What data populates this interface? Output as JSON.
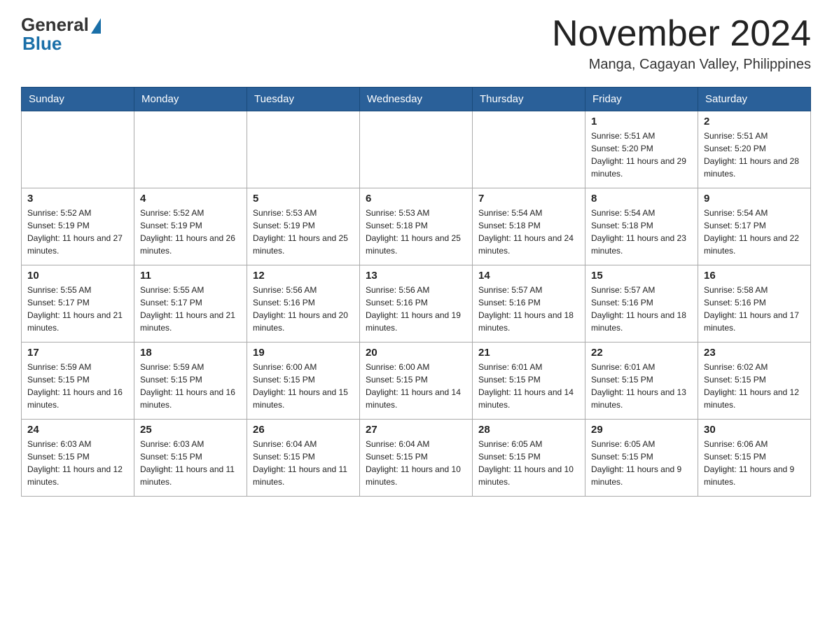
{
  "logo": {
    "general": "General",
    "blue": "Blue"
  },
  "header": {
    "title": "November 2024",
    "subtitle": "Manga, Cagayan Valley, Philippines"
  },
  "days_of_week": [
    "Sunday",
    "Monday",
    "Tuesday",
    "Wednesday",
    "Thursday",
    "Friday",
    "Saturday"
  ],
  "weeks": [
    [
      {
        "day": "",
        "info": ""
      },
      {
        "day": "",
        "info": ""
      },
      {
        "day": "",
        "info": ""
      },
      {
        "day": "",
        "info": ""
      },
      {
        "day": "",
        "info": ""
      },
      {
        "day": "1",
        "info": "Sunrise: 5:51 AM\nSunset: 5:20 PM\nDaylight: 11 hours and 29 minutes."
      },
      {
        "day": "2",
        "info": "Sunrise: 5:51 AM\nSunset: 5:20 PM\nDaylight: 11 hours and 28 minutes."
      }
    ],
    [
      {
        "day": "3",
        "info": "Sunrise: 5:52 AM\nSunset: 5:19 PM\nDaylight: 11 hours and 27 minutes."
      },
      {
        "day": "4",
        "info": "Sunrise: 5:52 AM\nSunset: 5:19 PM\nDaylight: 11 hours and 26 minutes."
      },
      {
        "day": "5",
        "info": "Sunrise: 5:53 AM\nSunset: 5:19 PM\nDaylight: 11 hours and 25 minutes."
      },
      {
        "day": "6",
        "info": "Sunrise: 5:53 AM\nSunset: 5:18 PM\nDaylight: 11 hours and 25 minutes."
      },
      {
        "day": "7",
        "info": "Sunrise: 5:54 AM\nSunset: 5:18 PM\nDaylight: 11 hours and 24 minutes."
      },
      {
        "day": "8",
        "info": "Sunrise: 5:54 AM\nSunset: 5:18 PM\nDaylight: 11 hours and 23 minutes."
      },
      {
        "day": "9",
        "info": "Sunrise: 5:54 AM\nSunset: 5:17 PM\nDaylight: 11 hours and 22 minutes."
      }
    ],
    [
      {
        "day": "10",
        "info": "Sunrise: 5:55 AM\nSunset: 5:17 PM\nDaylight: 11 hours and 21 minutes."
      },
      {
        "day": "11",
        "info": "Sunrise: 5:55 AM\nSunset: 5:17 PM\nDaylight: 11 hours and 21 minutes."
      },
      {
        "day": "12",
        "info": "Sunrise: 5:56 AM\nSunset: 5:16 PM\nDaylight: 11 hours and 20 minutes."
      },
      {
        "day": "13",
        "info": "Sunrise: 5:56 AM\nSunset: 5:16 PM\nDaylight: 11 hours and 19 minutes."
      },
      {
        "day": "14",
        "info": "Sunrise: 5:57 AM\nSunset: 5:16 PM\nDaylight: 11 hours and 18 minutes."
      },
      {
        "day": "15",
        "info": "Sunrise: 5:57 AM\nSunset: 5:16 PM\nDaylight: 11 hours and 18 minutes."
      },
      {
        "day": "16",
        "info": "Sunrise: 5:58 AM\nSunset: 5:16 PM\nDaylight: 11 hours and 17 minutes."
      }
    ],
    [
      {
        "day": "17",
        "info": "Sunrise: 5:59 AM\nSunset: 5:15 PM\nDaylight: 11 hours and 16 minutes."
      },
      {
        "day": "18",
        "info": "Sunrise: 5:59 AM\nSunset: 5:15 PM\nDaylight: 11 hours and 16 minutes."
      },
      {
        "day": "19",
        "info": "Sunrise: 6:00 AM\nSunset: 5:15 PM\nDaylight: 11 hours and 15 minutes."
      },
      {
        "day": "20",
        "info": "Sunrise: 6:00 AM\nSunset: 5:15 PM\nDaylight: 11 hours and 14 minutes."
      },
      {
        "day": "21",
        "info": "Sunrise: 6:01 AM\nSunset: 5:15 PM\nDaylight: 11 hours and 14 minutes."
      },
      {
        "day": "22",
        "info": "Sunrise: 6:01 AM\nSunset: 5:15 PM\nDaylight: 11 hours and 13 minutes."
      },
      {
        "day": "23",
        "info": "Sunrise: 6:02 AM\nSunset: 5:15 PM\nDaylight: 11 hours and 12 minutes."
      }
    ],
    [
      {
        "day": "24",
        "info": "Sunrise: 6:03 AM\nSunset: 5:15 PM\nDaylight: 11 hours and 12 minutes."
      },
      {
        "day": "25",
        "info": "Sunrise: 6:03 AM\nSunset: 5:15 PM\nDaylight: 11 hours and 11 minutes."
      },
      {
        "day": "26",
        "info": "Sunrise: 6:04 AM\nSunset: 5:15 PM\nDaylight: 11 hours and 11 minutes."
      },
      {
        "day": "27",
        "info": "Sunrise: 6:04 AM\nSunset: 5:15 PM\nDaylight: 11 hours and 10 minutes."
      },
      {
        "day": "28",
        "info": "Sunrise: 6:05 AM\nSunset: 5:15 PM\nDaylight: 11 hours and 10 minutes."
      },
      {
        "day": "29",
        "info": "Sunrise: 6:05 AM\nSunset: 5:15 PM\nDaylight: 11 hours and 9 minutes."
      },
      {
        "day": "30",
        "info": "Sunrise: 6:06 AM\nSunset: 5:15 PM\nDaylight: 11 hours and 9 minutes."
      }
    ]
  ]
}
